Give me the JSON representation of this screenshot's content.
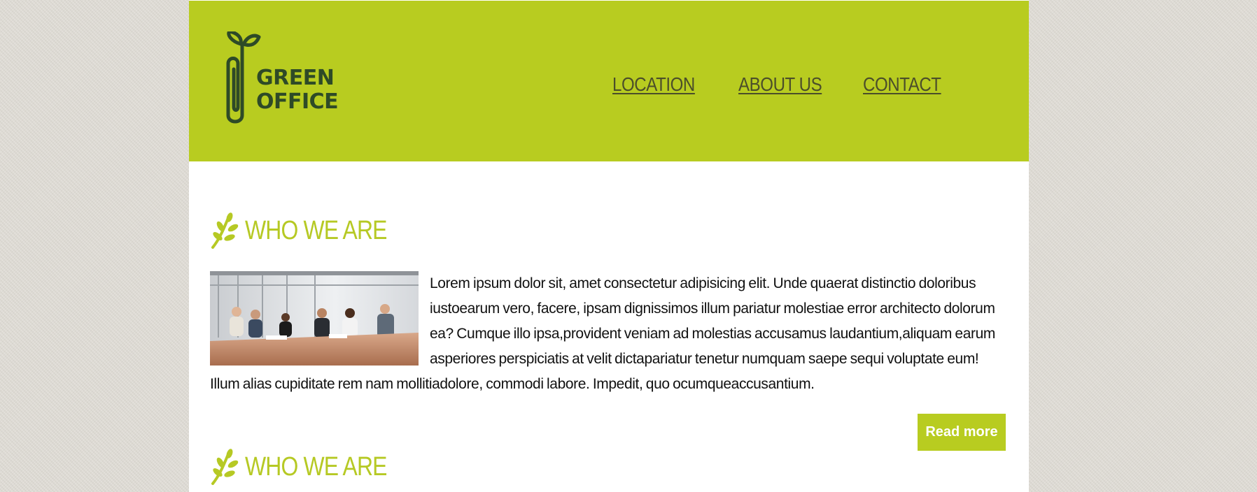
{
  "brand": {
    "line1": "GREEN",
    "line2": "OFFICE",
    "logo_icon": "paperclip-sprout-icon",
    "colors": {
      "header": "#b8cc20",
      "logo_text": "#2e4a27",
      "nav_text": "#4b4e2a",
      "accent": "#b6c924"
    }
  },
  "nav": {
    "items": [
      {
        "label": "LOCATION"
      },
      {
        "label": "ABOUT US"
      },
      {
        "label": "CONTACT"
      }
    ]
  },
  "sections": [
    {
      "icon": "leaf-branch-icon",
      "title": "WHO WE ARE",
      "image": "team-meeting-photo",
      "body": "Lorem ipsum dolor sit, amet consectetur adipisicing elit. Unde quaerat distinctio doloribus iustoearum vero, facere, ipsam dignissimos illum pariatur molestiae error architecto dolorum ea? Cumque illo ipsa,provident veniam ad molestias accusamus laudantium,aliquam earum asperiores perspiciatis at velit dictapariatur tenetur numquam saepe sequi voluptate eum! Illum alias cupiditate rem nam mollitiadolore, commodi labore. Impedit, quo ocumqueaccusantium.",
      "button": "Read more"
    },
    {
      "icon": "leaf-branch-icon",
      "title": "WHO WE ARE"
    }
  ]
}
